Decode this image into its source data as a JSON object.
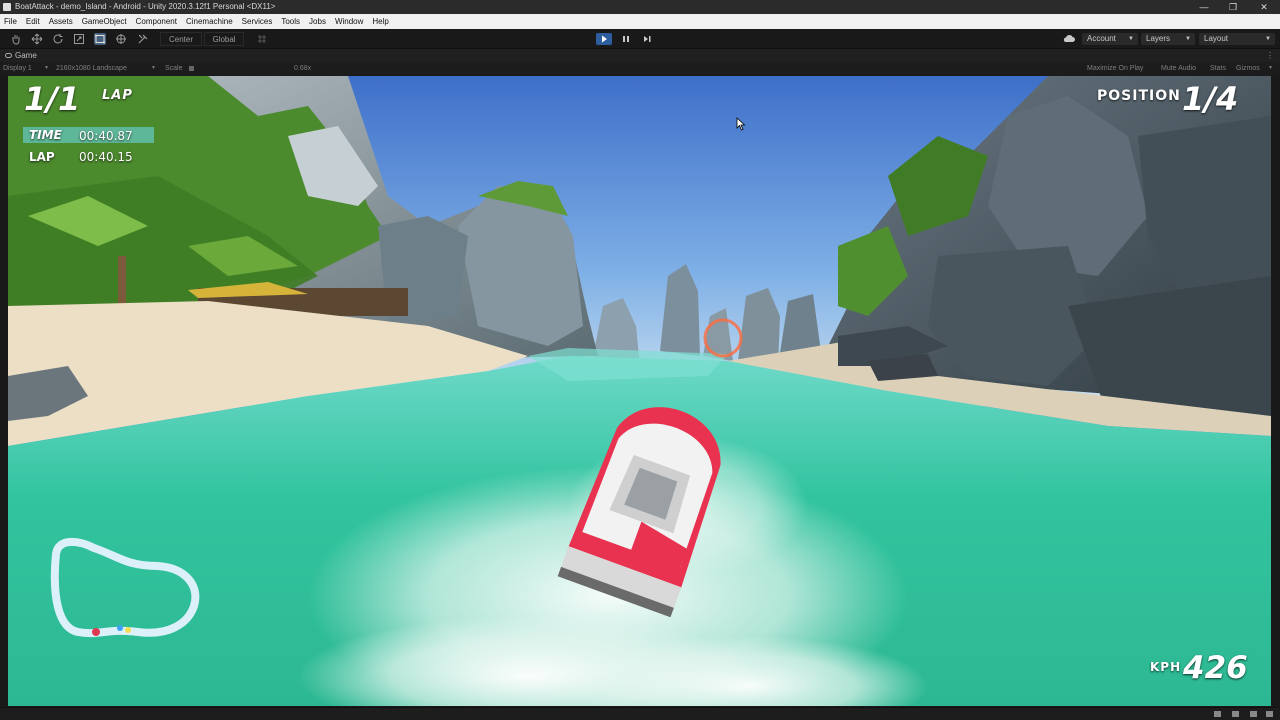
{
  "window": {
    "title": "BoatAttack - demo_Island - Android - Unity 2020.3.12f1 Personal <DX11>",
    "minimize_glyph": "—",
    "maximize_glyph": "❐",
    "close_glyph": "✕"
  },
  "menu": [
    "File",
    "Edit",
    "Assets",
    "GameObject",
    "Component",
    "Cinemachine",
    "Services",
    "Tools",
    "Jobs",
    "Window",
    "Help"
  ],
  "toolbar": {
    "pivot_label": "Center",
    "space_label": "Global",
    "account_label": "Account",
    "layers_label": "Layers",
    "layout_label": "Layout"
  },
  "game_view": {
    "tab_label": "Game",
    "display_label": "Display 1",
    "resolution_label": "2160x1080 Landscape",
    "scale_label": "Scale",
    "scale_value": "0.68x",
    "maximize_label": "Maximize On Play",
    "mute_label": "Mute Audio",
    "stats_label": "Stats",
    "gizmos_label": "Gizmos"
  },
  "hud": {
    "lap_count": "1/1",
    "lap_label": "LAP",
    "time_label": "TIME",
    "time_value": "00:40.87",
    "lap_time_label": "LAP",
    "lap_time_value": "00:40.15",
    "position_label": "POSITION",
    "position_value": "1/4",
    "speed_label": "KPH",
    "speed_value": "426"
  },
  "colors": {
    "water": "#35c9a5",
    "sky": "#4f80d6",
    "boat_red": "#e8324f",
    "editor_dark": "#191919",
    "play_active": "#2c5d9c"
  },
  "icons": [
    "hand-tool-icon",
    "move-tool-icon",
    "rotate-tool-icon",
    "scale-tool-icon",
    "rect-tool-icon",
    "transform-tool-icon",
    "custom-tool-icon",
    "play-icon",
    "pause-icon",
    "step-icon",
    "cloud-icon",
    "mouse-cursor-icon"
  ]
}
